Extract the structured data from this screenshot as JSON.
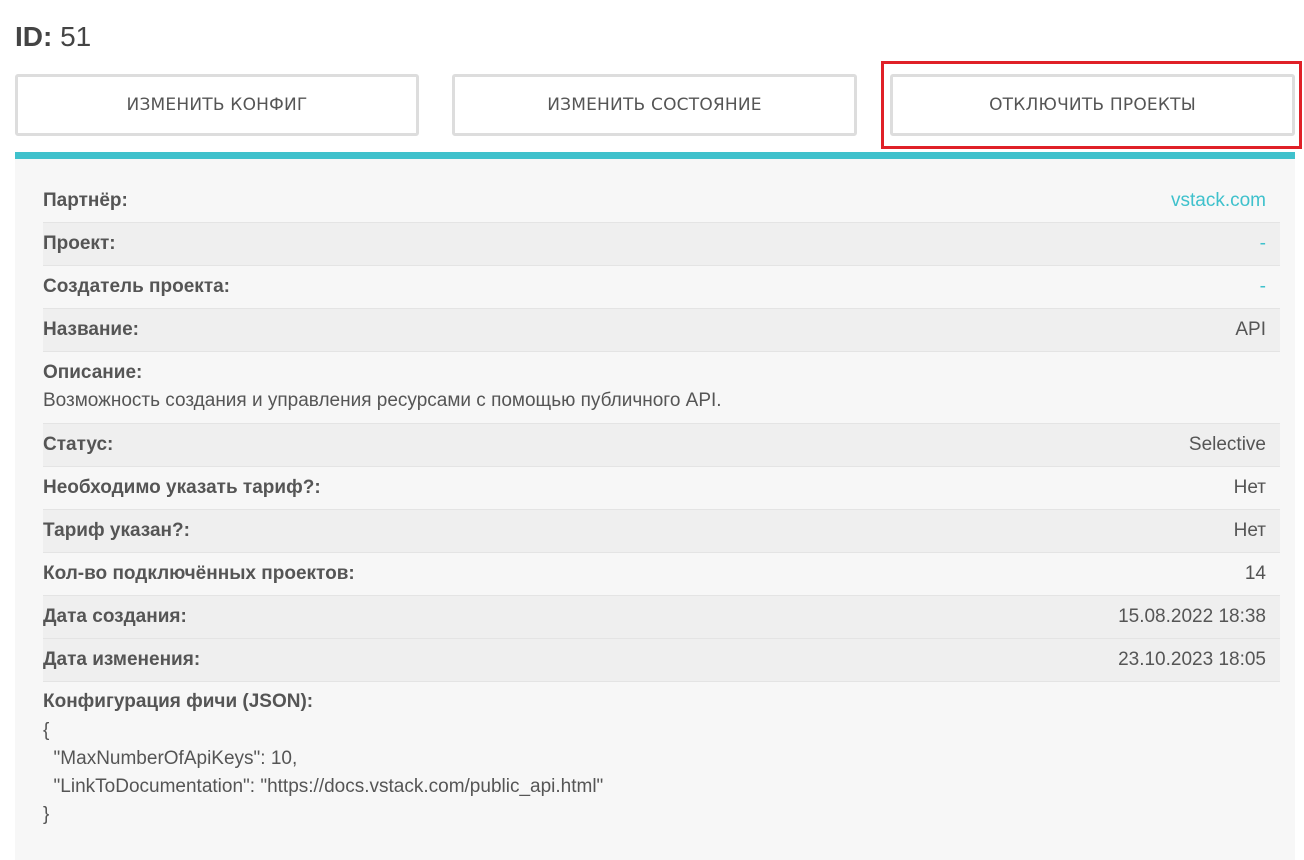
{
  "header": {
    "id_label": "ID:",
    "id_value": "51"
  },
  "actions": {
    "edit_config": "ИЗМЕНИТЬ КОНФИГ",
    "edit_state": "ИЗМЕНИТЬ СОСТОЯНИЕ",
    "disable_projects": "ОТКЛЮЧИТЬ ПРОЕКТЫ"
  },
  "details": {
    "partner": {
      "label": "Партнёр:",
      "value": "vstack.com"
    },
    "project": {
      "label": "Проект:",
      "value": "-"
    },
    "project_creator": {
      "label": "Создатель проекта:",
      "value": "-"
    },
    "name": {
      "label": "Название:",
      "value": "API"
    },
    "description": {
      "label": "Описание:",
      "value": "Возможность создания и управления ресурсами с помощью публичного API."
    },
    "status": {
      "label": "Статус:",
      "value": "Selective"
    },
    "tariff_required": {
      "label": "Необходимо указать тариф?:",
      "value": "Нет"
    },
    "tariff_set": {
      "label": "Тариф указан?:",
      "value": "Нет"
    },
    "connected_projects": {
      "label": "Кол-во подключённых проектов:",
      "value": "14"
    },
    "created_at": {
      "label": "Дата создания:",
      "value": "15.08.2022 18:38"
    },
    "updated_at": {
      "label": "Дата изменения:",
      "value": "23.10.2023 18:05"
    }
  },
  "config": {
    "label": "Конфигурация фичи (JSON):",
    "lines": [
      "{",
      "  \"MaxNumberOfApiKeys\": 10,",
      "  \"LinkToDocumentation\": \"https://docs.vstack.com/public_api.html\"",
      "}"
    ]
  },
  "colors": {
    "accent": "#3fc1cc",
    "highlight": "#e02028"
  }
}
